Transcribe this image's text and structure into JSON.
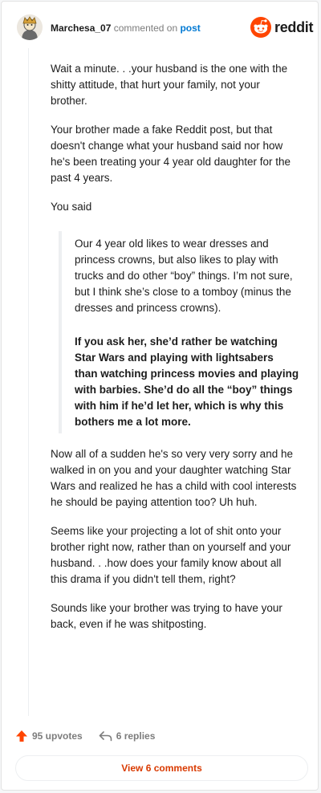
{
  "header": {
    "username": "Marchesa_07",
    "action_text": "commented on",
    "post_link": "post",
    "brand": "reddit"
  },
  "comment": {
    "p1": "Wait a minute. . .your husband is the one with the shitty attitude, that hurt your family, not your brother.",
    "p2": "Your brother made a fake Reddit post, but that doesn't change what your husband said nor how he's been treating your 4 year old daughter for the past 4 years.",
    "p3": "You said",
    "quote1": "Our 4 year old likes to wear dresses and princess crowns, but also likes to play with trucks and do other “boy” things. I’m not sure, but I think she’s close to a tomboy (minus the dresses and princess crowns).",
    "quote2": "If you ask her, she’d rather be watching Star Wars and playing with lightsabers than watching princess movies and playing with barbies. She’d do all the “boy” things with him if he’d let her, which is why this bothers me a lot more.",
    "p4": "Now all of a sudden he's so very very sorry and he walked in on you and your daughter watching Star Wars and realized he has a child with cool interests he should be paying attention too? Uh huh.",
    "p5": "Seems like your projecting a lot of shit onto your brother right now, rather than on yourself and your husband. . .how does your family know about all this drama if you didn't tell them, right?",
    "p6": "Sounds like your brother was trying to have your back, even if he was shitposting."
  },
  "footer": {
    "upvotes": "95 upvotes",
    "replies": "6 replies",
    "view_comments": "View 6 comments"
  },
  "colors": {
    "accent": "#ff4500",
    "link": "#0079d3",
    "view_button_text": "#d93a00"
  },
  "icons": {
    "upvote": "upvote-arrow-icon",
    "reply": "reply-arrow-icon",
    "logo": "reddit-snoo-icon",
    "avatar": "user-avatar"
  }
}
